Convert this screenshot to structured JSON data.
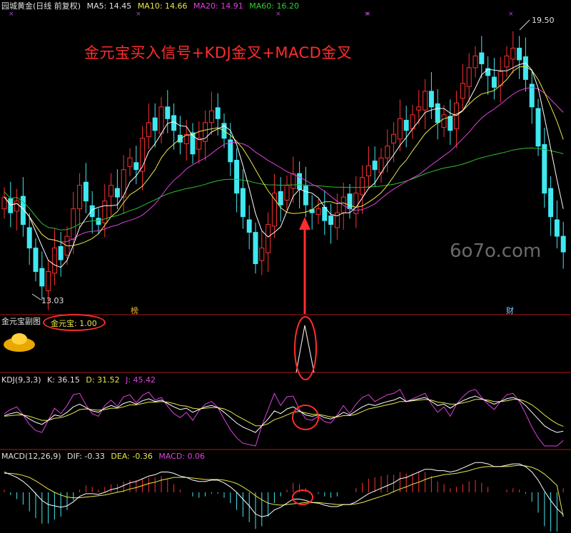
{
  "main_panel": {
    "title": "园城黄金(日线 前复权)",
    "ma5": "MA5: 14.45",
    "ma10": "MA10: 14.66",
    "ma20": "MA20: 14.91",
    "ma60": "MA60: 16.20",
    "high_label": "19.50",
    "low_label": "13.03",
    "banner": "金元宝买入信号+KDJ金叉+MACD金叉",
    "marker_bang": "榜",
    "marker_cai": "财"
  },
  "watermark": "6o7o.com",
  "sub_panel": {
    "title": "金元宝副图",
    "value_label": "金元宝: 1.00"
  },
  "kdj_panel": {
    "title": "KDJ(9,3,3)",
    "k": "K: 36.15",
    "d": "D: 31.52",
    "j": "J: 45.42"
  },
  "macd_panel": {
    "title": "MACD(12,26,9)",
    "dif": "DIF: -0.33",
    "dea": "DEA: -0.36",
    "macd": "MACD: 0.06"
  },
  "colors": {
    "up": "#ff3030",
    "down": "#40e8f0",
    "ma5": "#ffffff",
    "ma10": "#e8e84a",
    "ma20": "#e040e0",
    "ma60": "#30c030",
    "annotation": "#ff2d2d"
  },
  "chart_data": {
    "type": "candlestick",
    "title": "园城黄金(日线 前复权)",
    "ylim": [
      12.5,
      20.0
    ],
    "annotated_extremes": {
      "high": 19.5,
      "low": 13.03
    },
    "closes": [
      15.3,
      14.9,
      15.2,
      14.6,
      14.0,
      13.4,
      13.03,
      13.4,
      14.0,
      13.7,
      14.3,
      15.0,
      15.6,
      15.2,
      14.8,
      14.6,
      15.2,
      15.6,
      15.3,
      16.0,
      16.3,
      16.0,
      16.8,
      17.2,
      17.0,
      17.6,
      17.3,
      17.0,
      16.7,
      16.9,
      16.4,
      16.8,
      17.2,
      17.5,
      17.3,
      16.8,
      16.2,
      15.4,
      14.8,
      14.4,
      13.6,
      14.0,
      14.6,
      15.4,
      15.1,
      15.6,
      15.9,
      15.5,
      15.1,
      14.9,
      15.0,
      14.7,
      14.6,
      14.9,
      15.3,
      15.0,
      15.4,
      15.8,
      16.1,
      16.0,
      16.3,
      16.6,
      16.9,
      17.3,
      17.0,
      17.4,
      17.6,
      18.0,
      17.6,
      17.2,
      17.4,
      17.0,
      17.7,
      18.2,
      18.6,
      18.9,
      18.7,
      18.4,
      18.1,
      18.5,
      18.9,
      19.1,
      18.8,
      18.3,
      17.6,
      16.6,
      15.4,
      14.8,
      14.3,
      13.9
    ]
  },
  "kdj_data": {
    "K": [
      45,
      48,
      50,
      46,
      40,
      35,
      32,
      38,
      46,
      44,
      50,
      58,
      62,
      57,
      52,
      50,
      56,
      60,
      57,
      63,
      66,
      62,
      67,
      70,
      66,
      68,
      63,
      58,
      54,
      56,
      50,
      54,
      58,
      60,
      57,
      50,
      42,
      34,
      28,
      24,
      20,
      30,
      40,
      52,
      48,
      55,
      58,
      52,
      46,
      44,
      46,
      42,
      40,
      44,
      50,
      46,
      52,
      58,
      62,
      60,
      63,
      66,
      68,
      72,
      66,
      68,
      70,
      72,
      66,
      60,
      62,
      56,
      62,
      67,
      71,
      74,
      70,
      66,
      62,
      66,
      70,
      72,
      68,
      60,
      50,
      40,
      30,
      24,
      20,
      22
    ],
    "D": [
      44,
      45,
      46,
      46,
      44,
      41,
      38,
      38,
      41,
      42,
      45,
      49,
      54,
      55,
      54,
      53,
      54,
      56,
      56,
      58,
      61,
      61,
      63,
      65,
      65,
      66,
      65,
      63,
      60,
      59,
      56,
      55,
      56,
      57,
      57,
      55,
      51,
      45,
      40,
      35,
      30,
      30,
      33,
      39,
      42,
      46,
      50,
      51,
      49,
      47,
      47,
      45,
      43,
      43,
      45,
      45,
      47,
      51,
      55,
      57,
      59,
      61,
      63,
      66,
      66,
      67,
      68,
      69,
      68,
      65,
      64,
      62,
      62,
      64,
      66,
      69,
      69,
      68,
      66,
      66,
      67,
      69,
      69,
      66,
      61,
      54,
      46,
      39,
      33,
      29
    ],
    "J": [
      48,
      54,
      58,
      46,
      32,
      23,
      20,
      38,
      56,
      48,
      60,
      76,
      78,
      61,
      48,
      44,
      60,
      68,
      59,
      73,
      76,
      64,
      75,
      80,
      68,
      72,
      59,
      48,
      42,
      50,
      38,
      52,
      62,
      66,
      57,
      40,
      24,
      12,
      4,
      2,
      0,
      30,
      54,
      78,
      60,
      73,
      74,
      54,
      40,
      38,
      44,
      36,
      34,
      46,
      60,
      48,
      62,
      72,
      76,
      66,
      71,
      76,
      78,
      84,
      66,
      70,
      74,
      78,
      62,
      50,
      58,
      44,
      62,
      73,
      81,
      84,
      72,
      62,
      54,
      66,
      76,
      78,
      66,
      48,
      28,
      12,
      0,
      0,
      0,
      8
    ]
  },
  "macd_data": {
    "DIF": [
      0.3,
      0.26,
      0.22,
      0.16,
      0.08,
      -0.02,
      -0.12,
      -0.18,
      -0.2,
      -0.22,
      -0.2,
      -0.14,
      -0.06,
      -0.02,
      -0.02,
      -0.03,
      0.0,
      0.04,
      0.06,
      0.1,
      0.14,
      0.16,
      0.2,
      0.24,
      0.26,
      0.3,
      0.3,
      0.28,
      0.24,
      0.22,
      0.18,
      0.16,
      0.16,
      0.18,
      0.18,
      0.14,
      0.08,
      0.0,
      -0.1,
      -0.2,
      -0.32,
      -0.36,
      -0.34,
      -0.26,
      -0.22,
      -0.16,
      -0.1,
      -0.1,
      -0.12,
      -0.15,
      -0.16,
      -0.19,
      -0.21,
      -0.21,
      -0.18,
      -0.18,
      -0.14,
      -0.08,
      -0.02,
      0.02,
      0.06,
      0.1,
      0.14,
      0.2,
      0.22,
      0.26,
      0.3,
      0.34,
      0.34,
      0.32,
      0.32,
      0.3,
      0.32,
      0.36,
      0.4,
      0.44,
      0.44,
      0.42,
      0.38,
      0.38,
      0.4,
      0.42,
      0.42,
      0.38,
      0.3,
      0.18,
      0.02,
      -0.12,
      -0.24,
      -0.33
    ],
    "DEA": [
      0.28,
      0.28,
      0.27,
      0.25,
      0.22,
      0.17,
      0.11,
      0.05,
      0.0,
      -0.04,
      -0.07,
      -0.08,
      -0.08,
      -0.07,
      -0.06,
      -0.05,
      -0.04,
      -0.02,
      0.0,
      0.02,
      0.05,
      0.07,
      0.1,
      0.13,
      0.15,
      0.18,
      0.2,
      0.22,
      0.22,
      0.22,
      0.21,
      0.2,
      0.19,
      0.19,
      0.19,
      0.18,
      0.16,
      0.13,
      0.08,
      0.02,
      -0.05,
      -0.11,
      -0.16,
      -0.18,
      -0.19,
      -0.18,
      -0.17,
      -0.16,
      -0.15,
      -0.15,
      -0.15,
      -0.16,
      -0.17,
      -0.18,
      -0.18,
      -0.18,
      -0.17,
      -0.15,
      -0.12,
      -0.09,
      -0.06,
      -0.03,
      0.01,
      0.05,
      0.08,
      0.12,
      0.15,
      0.19,
      0.22,
      0.24,
      0.26,
      0.27,
      0.28,
      0.3,
      0.32,
      0.35,
      0.37,
      0.38,
      0.38,
      0.38,
      0.38,
      0.39,
      0.4,
      0.39,
      0.37,
      0.33,
      0.27,
      0.19,
      0.1,
      -0.36
    ]
  }
}
